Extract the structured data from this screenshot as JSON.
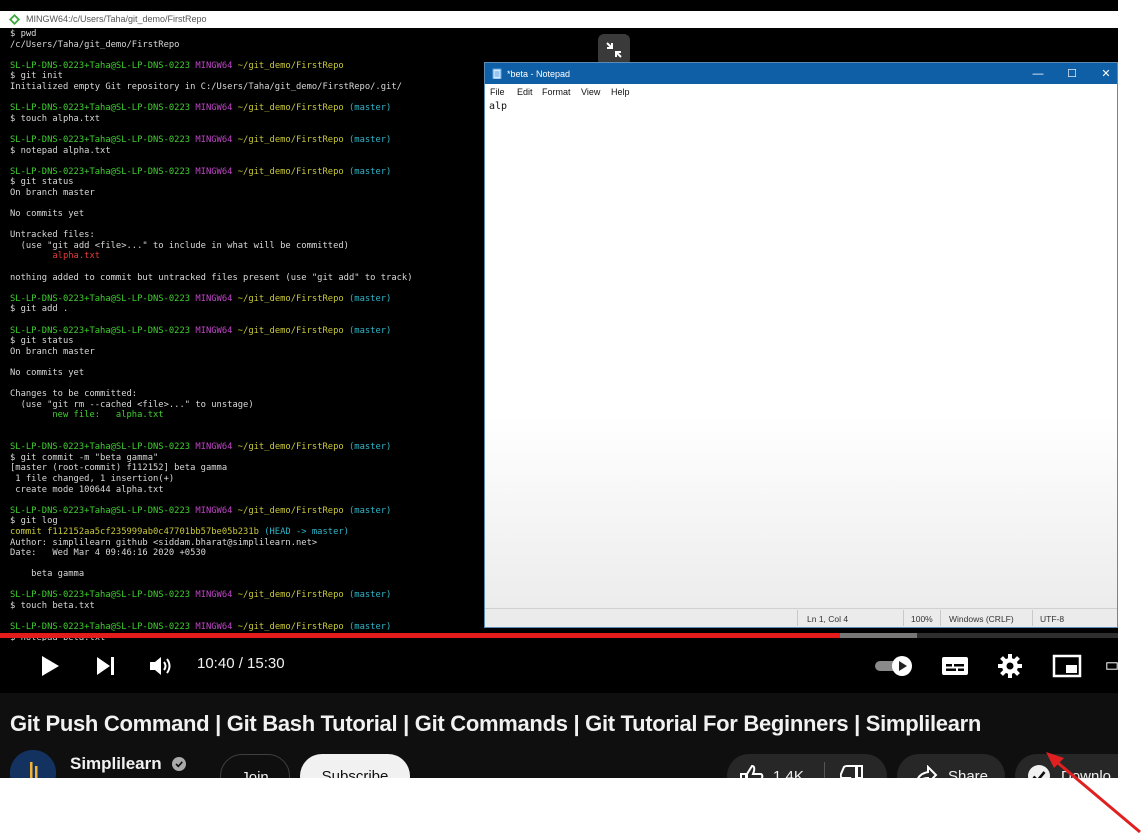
{
  "terminal": {
    "title": "MINGW64:/c/Users/Taha/git_demo/FirstRepo",
    "lines": [
      [
        {
          "t": "$ pwd",
          "c": "w"
        }
      ],
      [
        {
          "t": "/c/Users/Taha/git_demo/FirstRepo",
          "c": "w"
        }
      ],
      [
        {
          "t": "",
          "c": "w"
        }
      ],
      [
        {
          "t": "SL-LP-DNS-0223+Taha@SL-LP-DNS-0223 ",
          "c": "g"
        },
        {
          "t": "MINGW64 ",
          "c": "m"
        },
        {
          "t": "~/git_demo/FirstRepo",
          "c": "y"
        }
      ],
      [
        {
          "t": "$ git init",
          "c": "w"
        }
      ],
      [
        {
          "t": "Initialized empty Git repository in C:/Users/Taha/git_demo/FirstRepo/.git/",
          "c": "w"
        }
      ],
      [
        {
          "t": "",
          "c": "w"
        }
      ],
      [
        {
          "t": "SL-LP-DNS-0223+Taha@SL-LP-DNS-0223 ",
          "c": "g"
        },
        {
          "t": "MINGW64 ",
          "c": "m"
        },
        {
          "t": "~/git_demo/FirstRepo ",
          "c": "y"
        },
        {
          "t": "(master)",
          "c": "c"
        }
      ],
      [
        {
          "t": "$ touch alpha.txt",
          "c": "w"
        }
      ],
      [
        {
          "t": "",
          "c": "w"
        }
      ],
      [
        {
          "t": "SL-LP-DNS-0223+Taha@SL-LP-DNS-0223 ",
          "c": "g"
        },
        {
          "t": "MINGW64 ",
          "c": "m"
        },
        {
          "t": "~/git_demo/FirstRepo ",
          "c": "y"
        },
        {
          "t": "(master)",
          "c": "c"
        }
      ],
      [
        {
          "t": "$ notepad alpha.txt",
          "c": "w"
        }
      ],
      [
        {
          "t": "",
          "c": "w"
        }
      ],
      [
        {
          "t": "SL-LP-DNS-0223+Taha@SL-LP-DNS-0223 ",
          "c": "g"
        },
        {
          "t": "MINGW64 ",
          "c": "m"
        },
        {
          "t": "~/git_demo/FirstRepo ",
          "c": "y"
        },
        {
          "t": "(master)",
          "c": "c"
        }
      ],
      [
        {
          "t": "$ git status",
          "c": "w"
        }
      ],
      [
        {
          "t": "On branch master",
          "c": "w"
        }
      ],
      [
        {
          "t": "",
          "c": "w"
        }
      ],
      [
        {
          "t": "No commits yet",
          "c": "w"
        }
      ],
      [
        {
          "t": "",
          "c": "w"
        }
      ],
      [
        {
          "t": "Untracked files:",
          "c": "w"
        }
      ],
      [
        {
          "t": "  (use \"git add <file>...\" to include in what will be committed)",
          "c": "w"
        }
      ],
      [
        {
          "t": "        alpha.txt",
          "c": "r"
        }
      ],
      [
        {
          "t": "",
          "c": "w"
        }
      ],
      [
        {
          "t": "nothing added to commit but untracked files present (use \"git add\" to track)",
          "c": "w"
        }
      ],
      [
        {
          "t": "",
          "c": "w"
        }
      ],
      [
        {
          "t": "SL-LP-DNS-0223+Taha@SL-LP-DNS-0223 ",
          "c": "g"
        },
        {
          "t": "MINGW64 ",
          "c": "m"
        },
        {
          "t": "~/git_demo/FirstRepo ",
          "c": "y"
        },
        {
          "t": "(master)",
          "c": "c"
        }
      ],
      [
        {
          "t": "$ git add .",
          "c": "w"
        }
      ],
      [
        {
          "t": "",
          "c": "w"
        }
      ],
      [
        {
          "t": "SL-LP-DNS-0223+Taha@SL-LP-DNS-0223 ",
          "c": "g"
        },
        {
          "t": "MINGW64 ",
          "c": "m"
        },
        {
          "t": "~/git_demo/FirstRepo ",
          "c": "y"
        },
        {
          "t": "(master)",
          "c": "c"
        }
      ],
      [
        {
          "t": "$ git status",
          "c": "w"
        }
      ],
      [
        {
          "t": "On branch master",
          "c": "w"
        }
      ],
      [
        {
          "t": "",
          "c": "w"
        }
      ],
      [
        {
          "t": "No commits yet",
          "c": "w"
        }
      ],
      [
        {
          "t": "",
          "c": "w"
        }
      ],
      [
        {
          "t": "Changes to be committed:",
          "c": "w"
        }
      ],
      [
        {
          "t": "  (use \"git rm --cached <file>...\" to unstage)",
          "c": "w"
        }
      ],
      [
        {
          "t": "        new file:   alpha.txt",
          "c": "g"
        }
      ],
      [
        {
          "t": "",
          "c": "w"
        }
      ],
      [
        {
          "t": "",
          "c": "w"
        }
      ],
      [
        {
          "t": "SL-LP-DNS-0223+Taha@SL-LP-DNS-0223 ",
          "c": "g"
        },
        {
          "t": "MINGW64 ",
          "c": "m"
        },
        {
          "t": "~/git_demo/FirstRepo ",
          "c": "y"
        },
        {
          "t": "(master)",
          "c": "c"
        }
      ],
      [
        {
          "t": "$ git commit -m \"beta gamma\"",
          "c": "w"
        }
      ],
      [
        {
          "t": "[master (root-commit) f112152] beta gamma",
          "c": "w"
        }
      ],
      [
        {
          "t": " 1 file changed, 1 insertion(+)",
          "c": "w"
        }
      ],
      [
        {
          "t": " create mode 100644 alpha.txt",
          "c": "w"
        }
      ],
      [
        {
          "t": "",
          "c": "w"
        }
      ],
      [
        {
          "t": "SL-LP-DNS-0223+Taha@SL-LP-DNS-0223 ",
          "c": "g"
        },
        {
          "t": "MINGW64 ",
          "c": "m"
        },
        {
          "t": "~/git_demo/FirstRepo ",
          "c": "y"
        },
        {
          "t": "(master)",
          "c": "c"
        }
      ],
      [
        {
          "t": "$ git log",
          "c": "w"
        }
      ],
      [
        {
          "t": "commit f112152aa5cf235999ab0c47701bb57be05b231b ",
          "c": "y"
        },
        {
          "t": "(HEAD -> master)",
          "c": "c"
        }
      ],
      [
        {
          "t": "Author: simplilearn github <siddam.bharat@simplilearn.net>",
          "c": "w"
        }
      ],
      [
        {
          "t": "Date:   Wed Mar 4 09:46:16 2020 +0530",
          "c": "w"
        }
      ],
      [
        {
          "t": "",
          "c": "w"
        }
      ],
      [
        {
          "t": "    beta gamma",
          "c": "w"
        }
      ],
      [
        {
          "t": "",
          "c": "w"
        }
      ],
      [
        {
          "t": "SL-LP-DNS-0223+Taha@SL-LP-DNS-0223 ",
          "c": "g"
        },
        {
          "t": "MINGW64 ",
          "c": "m"
        },
        {
          "t": "~/git_demo/FirstRepo ",
          "c": "y"
        },
        {
          "t": "(master)",
          "c": "c"
        }
      ],
      [
        {
          "t": "$ touch beta.txt",
          "c": "w"
        }
      ],
      [
        {
          "t": "",
          "c": "w"
        }
      ],
      [
        {
          "t": "SL-LP-DNS-0223+Taha@SL-LP-DNS-0223 ",
          "c": "g"
        },
        {
          "t": "MINGW64 ",
          "c": "m"
        },
        {
          "t": "~/git_demo/FirstRepo ",
          "c": "y"
        },
        {
          "t": "(master)",
          "c": "c"
        }
      ],
      [
        {
          "t": "$ notepad beta.txt",
          "c": "w"
        }
      ]
    ]
  },
  "notepad": {
    "title": "*beta - Notepad",
    "menu": [
      "File",
      "Edit",
      "Format",
      "View",
      "Help"
    ],
    "content": "alp",
    "status": {
      "position": "Ln 1, Col 4",
      "zoom": "100%",
      "line_ending": "Windows (CRLF)",
      "encoding": "UTF-8"
    }
  },
  "player": {
    "time": "10:40 / 15:30",
    "progress_played_fraction": 0.7513,
    "progress_buffered_fraction": 0.82
  },
  "video": {
    "title": "Git Push Command | Git Bash Tutorial | Git Commands | Git Tutorial For Beginners | Simplilearn",
    "channel": "Simplilearn",
    "join_label": "Join",
    "subscribe_label": "Subscribe",
    "likes": "1.4K",
    "share_label": "Share",
    "download_label": "Downlo"
  },
  "colors": {
    "progress": "#e31b1b",
    "annotation_arrow": "#e02020"
  }
}
